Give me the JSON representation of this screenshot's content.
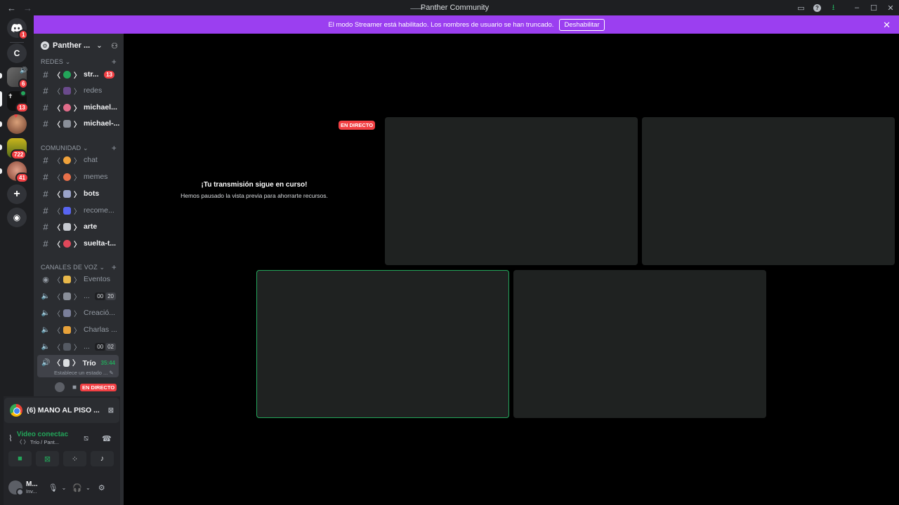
{
  "window": {
    "title": "Panther Community",
    "back_glyph": "←",
    "forward_glyph": "→",
    "minimize_glyph": "–",
    "maximize_glyph": "☐",
    "close_glyph": "✕",
    "inbox_glyph": "▭",
    "help_glyph": "?",
    "download_glyph": "⭳"
  },
  "guilds": {
    "home_badge": "1",
    "folder_label": "C",
    "items": [
      {
        "badge": "6"
      },
      {
        "badge": "13"
      },
      {
        "badge": ""
      },
      {
        "badge": "722"
      },
      {
        "badge": "41"
      }
    ],
    "add_glyph": "+",
    "explore_glyph": "◉"
  },
  "banner": {
    "text": "El modo Streamer está habilitado. Los nombres de usuario se han truncado.",
    "button": "Deshabilitar",
    "close_glyph": "✕"
  },
  "server": {
    "name": "Panther ...",
    "chevron": "⌄",
    "invite_glyph": "⚇"
  },
  "categories": [
    {
      "label": "REDES ⌄",
      "plus": "+"
    },
    {
      "label": "COMUNIDAD ⌄",
      "plus": "+"
    },
    {
      "label": "CANALES DE VOZ ⌄",
      "plus": "+"
    }
  ],
  "text_channels": [
    {
      "name": "str...",
      "prefix": "〈",
      "suffix": "〉",
      "badge": "13"
    },
    {
      "name": "redes",
      "prefix": "〈",
      "suffix": "〉"
    },
    {
      "name": "michael...",
      "prefix": "〈",
      "suffix": "〉"
    },
    {
      "name": "michael-...",
      "prefix": "〈",
      "suffix": "〉"
    },
    {
      "name": "chat",
      "prefix": "〈",
      "suffix": "〉"
    },
    {
      "name": "memes",
      "prefix": "〈",
      "suffix": "〉"
    },
    {
      "name": "bots",
      "prefix": "〈",
      "suffix": "〉"
    },
    {
      "name": "recome...",
      "prefix": "〈",
      "suffix": "〉"
    },
    {
      "name": "arte",
      "prefix": "〈",
      "suffix": "〉"
    },
    {
      "name": "suelta-t...",
      "prefix": "〈",
      "suffix": "〉"
    }
  ],
  "voice_channels": [
    {
      "name": "Eventos",
      "prefix": "〈",
      "suffix": "〉"
    },
    {
      "name": "...",
      "prefix": "〈",
      "suffix": "〉",
      "count_a": "00",
      "count_b": "20"
    },
    {
      "name": "Creació...",
      "prefix": "〈",
      "suffix": "〉"
    },
    {
      "name": "Charlas ...",
      "prefix": "〈",
      "suffix": "〉"
    },
    {
      "name": "...",
      "prefix": "〈",
      "suffix": "〉",
      "count_a": "00",
      "count_b": "02"
    }
  ],
  "active_voice": {
    "name": "Trío",
    "prefix": "〈",
    "suffix": "〉",
    "timer": "35:44",
    "status": "Establece un estado ...",
    "live_tag": "EN DIRECTO"
  },
  "rtc": {
    "app_title": "(6) MANO AL PISO ...",
    "connection": "Video conectac",
    "channel": "〈 〉 Trío / Pant...",
    "close_glyph": "⊠"
  },
  "user": {
    "name": "M...",
    "status": "Inv..."
  },
  "stage": {
    "live_tag": "EN DIRECTO",
    "heading": "¡Tu transmisión sigue en curso!",
    "subtext": "Hemos pausado la vista previa para ahorrarte recursos."
  },
  "colors": {
    "accent": "#9b3ff0",
    "live": "#f23f43",
    "speaking": "#23a55a"
  }
}
